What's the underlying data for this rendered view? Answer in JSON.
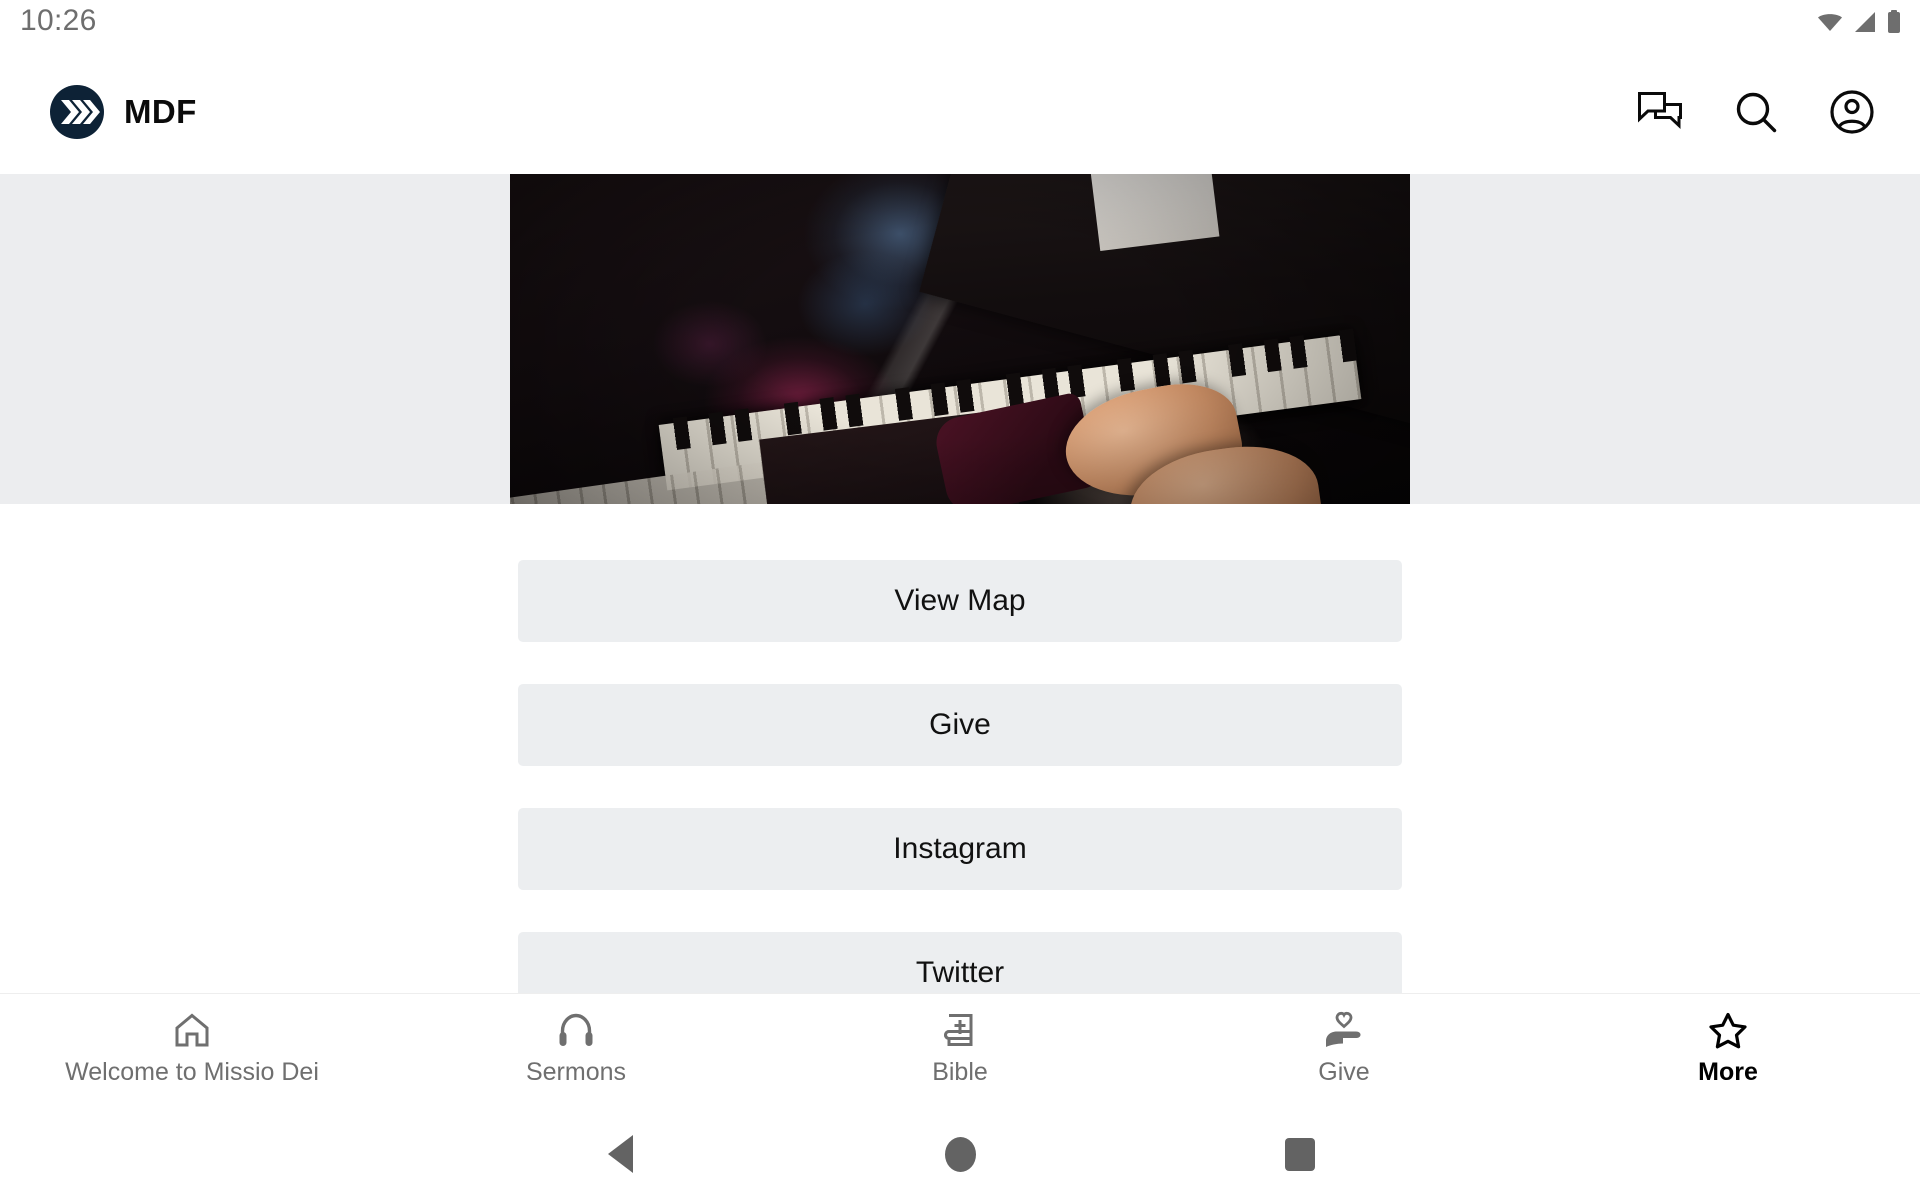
{
  "status_bar": {
    "clock": "10:26",
    "icons": [
      "wifi-icon",
      "cellular-signal-icon",
      "battery-icon"
    ],
    "text_color": "#6e6e6e"
  },
  "header": {
    "logo_icon": "mdf-chevrons-logo-icon",
    "logo_color": "#0d2236",
    "title": "MDF",
    "actions": [
      {
        "name": "messages-icon",
        "label": "Messages"
      },
      {
        "name": "search-icon",
        "label": "Search"
      },
      {
        "name": "account-icon",
        "label": "Account"
      }
    ]
  },
  "hero": {
    "media_type": "video-thumbnail",
    "alt": "Close-up of hands playing a piano in dim light",
    "band_color": "#ecedef"
  },
  "main": {
    "buttons": [
      {
        "label": "View Map",
        "name": "view-map-button"
      },
      {
        "label": "Give",
        "name": "give-button"
      },
      {
        "label": "Instagram",
        "name": "instagram-button"
      },
      {
        "label": "Twitter",
        "name": "twitter-button"
      }
    ],
    "button_bg": "#eceef0",
    "button_text_color": "#111111"
  },
  "tab_bar": {
    "active_index": 4,
    "inactive_color": "#6f6f6f",
    "active_color": "#000000",
    "items": [
      {
        "label": "Welcome to Missio Dei",
        "icon": "home-icon"
      },
      {
        "label": "Sermons",
        "icon": "headphones-icon"
      },
      {
        "label": "Bible",
        "icon": "bible-book-cross-icon"
      },
      {
        "label": "Give",
        "icon": "hand-holding-heart-icon"
      },
      {
        "label": "More",
        "icon": "star-icon"
      }
    ]
  },
  "system_nav": {
    "buttons": [
      {
        "name": "android-back-button",
        "label": "Back"
      },
      {
        "name": "android-home-button",
        "label": "Home"
      },
      {
        "name": "android-recents-button",
        "label": "Recents"
      }
    ],
    "color": "#636363"
  }
}
